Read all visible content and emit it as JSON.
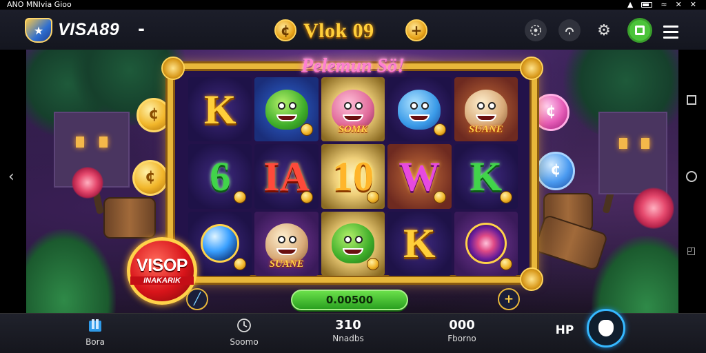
{
  "status_bar": {
    "left_text": "ANO MNIvia Gioo",
    "icons": [
      "settings-icon",
      "whatsapp-icon",
      "battery-icon",
      "signal-icon",
      "wifi-icon",
      "close-icon",
      "close-icon"
    ]
  },
  "header": {
    "brand": "VISA89",
    "brand_suffix": "-",
    "game_title": "Vlok 09",
    "coin_left": "¢",
    "coin_right": "+",
    "icons": [
      "support-icon",
      "headset-icon",
      "gear-icon",
      "screen-icon",
      "menu-icon"
    ]
  },
  "game": {
    "banner": "Pelemun Sö!",
    "reels": [
      [
        {
          "kind": "letter",
          "text": "K",
          "color": "gold",
          "bg": "dark"
        },
        {
          "kind": "creature",
          "creature": "green",
          "bg": "blue"
        },
        {
          "kind": "creature",
          "creature": "pink",
          "label": "SOMK",
          "bg": "gold"
        },
        {
          "kind": "creature",
          "creature": "blue",
          "bg": "dark"
        },
        {
          "kind": "creature",
          "creature": "tan",
          "label": "SUANE",
          "bg": "rose"
        }
      ],
      [
        {
          "kind": "letter",
          "text": "6",
          "color": "green",
          "bg": "dark"
        },
        {
          "kind": "letter",
          "text": "IA",
          "color": "red",
          "bg": "dark"
        },
        {
          "kind": "letter",
          "text": "10",
          "color": "orange",
          "bg": "gold"
        },
        {
          "kind": "letter",
          "text": "W",
          "color": "magenta",
          "bg": "rose"
        },
        {
          "kind": "letter",
          "text": "K",
          "color": "green",
          "bg": "dark"
        }
      ],
      [
        {
          "kind": "gem",
          "bg": "dark"
        },
        {
          "kind": "creature",
          "creature": "tan",
          "label": "SUANE",
          "bg": "purple"
        },
        {
          "kind": "creature",
          "creature": "green",
          "bg": "gold"
        },
        {
          "kind": "letter",
          "text": "K",
          "color": "gold",
          "bg": "dark"
        },
        {
          "kind": "rose",
          "bg": "purple"
        }
      ]
    ],
    "promo": {
      "title": "VISOP",
      "subtitle": "INAKARIK"
    },
    "bet_value": "0.00500",
    "left_btn": "╱",
    "plus_btn": "+"
  },
  "bottom_nav": {
    "items": [
      {
        "id": "home",
        "icon": "home-icon",
        "label": "Bora"
      },
      {
        "id": "score",
        "icon": "clock-icon",
        "label": "Soomo"
      },
      {
        "id": "bet",
        "value": "310",
        "label": "Nnadbs"
      },
      {
        "id": "balance",
        "value": "000",
        "label": "Fborno"
      },
      {
        "id": "hp",
        "value": "HP"
      }
    ],
    "shield_icon": "shield-icon"
  }
}
